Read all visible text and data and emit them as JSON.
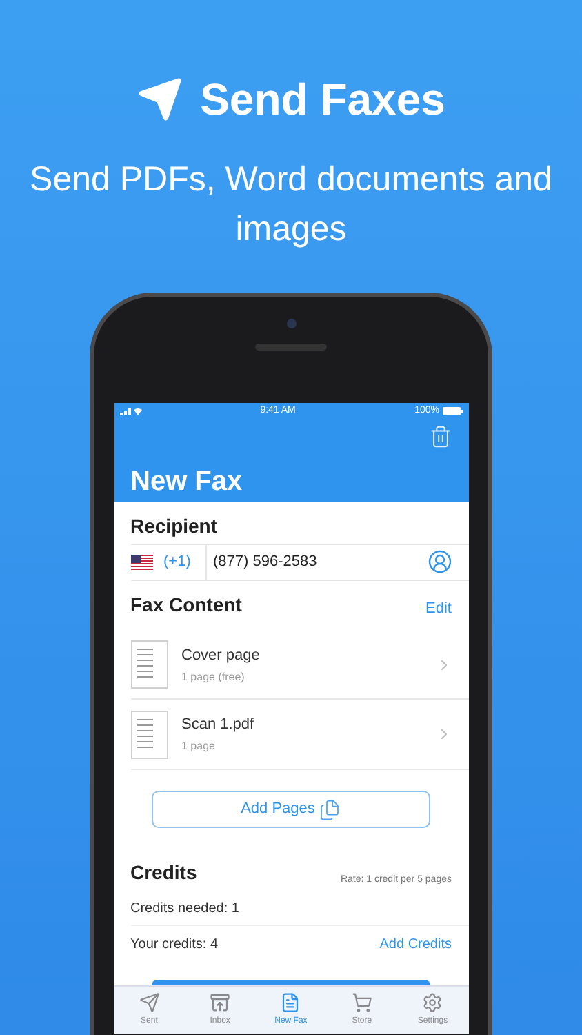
{
  "headline": {
    "title": "Send Faxes",
    "subtitle": "Send PDFs, Word documents and images"
  },
  "status_bar": {
    "time": "9:41 AM",
    "battery": "100%"
  },
  "nav": {
    "title": "New Fax"
  },
  "recipient": {
    "heading": "Recipient",
    "country_code": "(+1)",
    "number": "(877) 596-2583"
  },
  "fax_content": {
    "heading": "Fax Content",
    "edit": "Edit",
    "add_button": "Add Pages",
    "items": [
      {
        "name": "Cover page",
        "detail": "1 page (free)"
      },
      {
        "name": "Scan 1.pdf",
        "detail": "1 page"
      }
    ]
  },
  "credits": {
    "heading": "Credits",
    "rate": "Rate: 1 credit per 5 pages",
    "needed": "Credits needed: 1",
    "yours": "Your credits: 4",
    "add": "Add Credits"
  },
  "tabs": [
    {
      "kind": "sent",
      "label": "Sent",
      "selected": false
    },
    {
      "kind": "inbox",
      "label": "Inbox",
      "selected": false
    },
    {
      "kind": "new",
      "label": "New Fax",
      "selected": true
    },
    {
      "kind": "store",
      "label": "Store",
      "selected": false
    },
    {
      "kind": "settings",
      "label": "Settings",
      "selected": false
    }
  ]
}
